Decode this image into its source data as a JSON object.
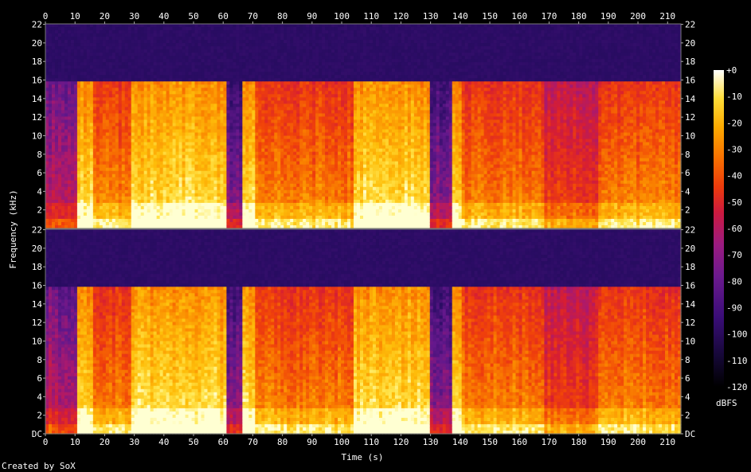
{
  "chart_data": {
    "type": "heatmap",
    "title": "",
    "xlabel": "Time (s)",
    "ylabel": "Frequency (kHz)",
    "credit": "Created by SoX",
    "x_ticks": [
      0,
      10,
      20,
      30,
      40,
      50,
      60,
      70,
      80,
      90,
      100,
      110,
      120,
      130,
      140,
      150,
      160,
      170,
      180,
      190,
      200,
      210
    ],
    "xlim": [
      0,
      214.5
    ],
    "ylim_khz": [
      0,
      22.05
    ],
    "y_ticks_top": [
      "22",
      "20",
      "18",
      "16",
      "14",
      "12",
      "10",
      "8",
      "6",
      "4",
      "2"
    ],
    "y_ticks_bottom": [
      "22",
      "20",
      "18",
      "16",
      "14",
      "12",
      "10",
      "8",
      "6",
      "4",
      "2",
      "DC"
    ],
    "y_tick_values": [
      22,
      20,
      18,
      16,
      14,
      12,
      10,
      8,
      6,
      4,
      2,
      0
    ],
    "channels": 2,
    "colorbar": {
      "label": "dBFS",
      "ticks": [
        "+0",
        "-10",
        "-20",
        "-30",
        "-40",
        "-50",
        "-60",
        "-70",
        "-80",
        "-90",
        "-100",
        "-110",
        "-120"
      ],
      "range_db": [
        -120,
        0
      ],
      "colors": [
        "#000000",
        "#1c0a4a",
        "#3d0f7a",
        "#6a1b8c",
        "#9a1b7e",
        "#c81a4a",
        "#e8300f",
        "#f76a00",
        "#fda600",
        "#ffd930",
        "#ffffc8",
        "#ffffff"
      ]
    },
    "spectral_cutoff_khz": 16,
    "segments": [
      {
        "start": 0,
        "end": 10.5,
        "intensity": "low"
      },
      {
        "start": 10.5,
        "end": 16,
        "intensity": "high"
      },
      {
        "start": 16,
        "end": 29,
        "intensity": "medium"
      },
      {
        "start": 29,
        "end": 61,
        "intensity": "high"
      },
      {
        "start": 61,
        "end": 66,
        "intensity": "gap"
      },
      {
        "start": 66,
        "end": 71,
        "intensity": "high"
      },
      {
        "start": 71,
        "end": 104,
        "intensity": "medium"
      },
      {
        "start": 104,
        "end": 130,
        "intensity": "high"
      },
      {
        "start": 130,
        "end": 137,
        "intensity": "gap"
      },
      {
        "start": 137,
        "end": 141,
        "intensity": "high"
      },
      {
        "start": 141,
        "end": 168,
        "intensity": "medium"
      },
      {
        "start": 168,
        "end": 187,
        "intensity": "medium-low"
      },
      {
        "start": 187,
        "end": 214.5,
        "intensity": "medium"
      }
    ]
  }
}
